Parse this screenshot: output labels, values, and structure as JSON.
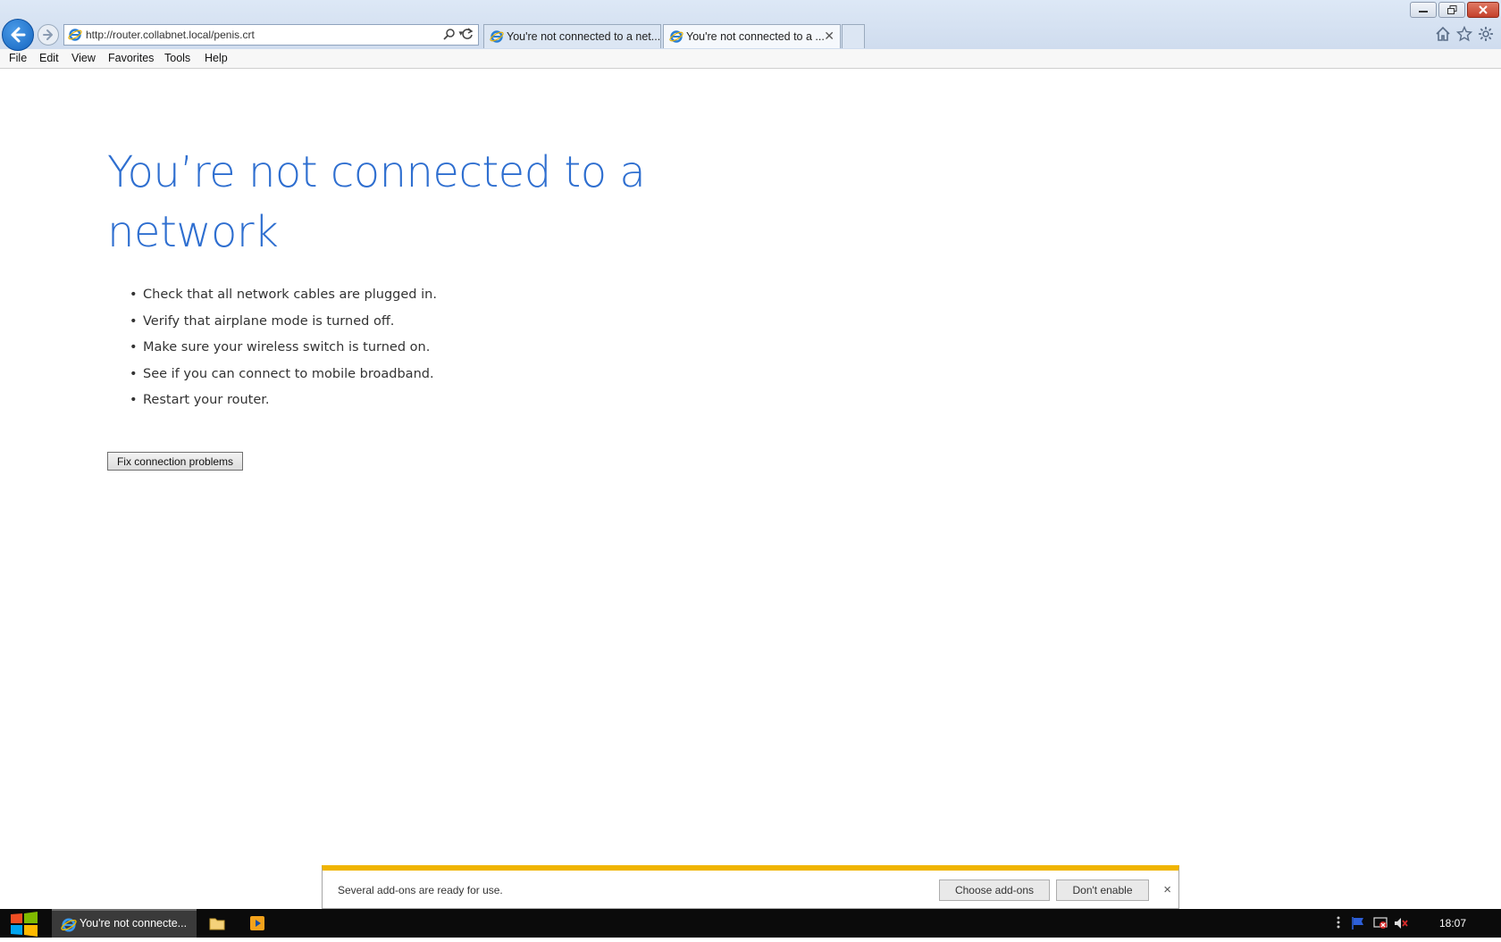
{
  "browser": {
    "address_url": "http://router.collabnet.local/penis.crt",
    "tabs": [
      {
        "title": "You're not connected to a net..."
      },
      {
        "title": "You're not connected to a ..."
      }
    ]
  },
  "menu": [
    "File",
    "Edit",
    "View",
    "Favorites",
    "Tools",
    "Help"
  ],
  "page": {
    "title": "You’re not connected to a network",
    "tips": [
      "Check that all network cables are plugged in.",
      "Verify that airplane mode is turned off.",
      "Make sure your wireless switch is turned on.",
      "See if you can connect to mobile broadband.",
      "Restart your router."
    ],
    "bullet": "•",
    "fix_button": "Fix connection problems"
  },
  "notification": {
    "text": "Several add-ons are ready for use.",
    "choose_label": "Choose add-ons",
    "dont_enable_label": "Don't enable",
    "close_glyph": "×"
  },
  "taskbar": {
    "ie_label": "You're not connecte...",
    "clock": "18:07"
  },
  "colors": {
    "title_blue": "#2f6fd0",
    "notification_accent": "#f0b400",
    "taskbar": "#0b0b0b"
  },
  "icons": [
    "back-arrow-icon",
    "forward-arrow-icon",
    "ie-icon",
    "search-icon",
    "refresh-icon",
    "home-icon",
    "star-icon",
    "gear-icon",
    "windows-logo-icon",
    "folder-icon",
    "media-player-icon",
    "flag-icon",
    "network-icon",
    "volume-muted-icon"
  ]
}
